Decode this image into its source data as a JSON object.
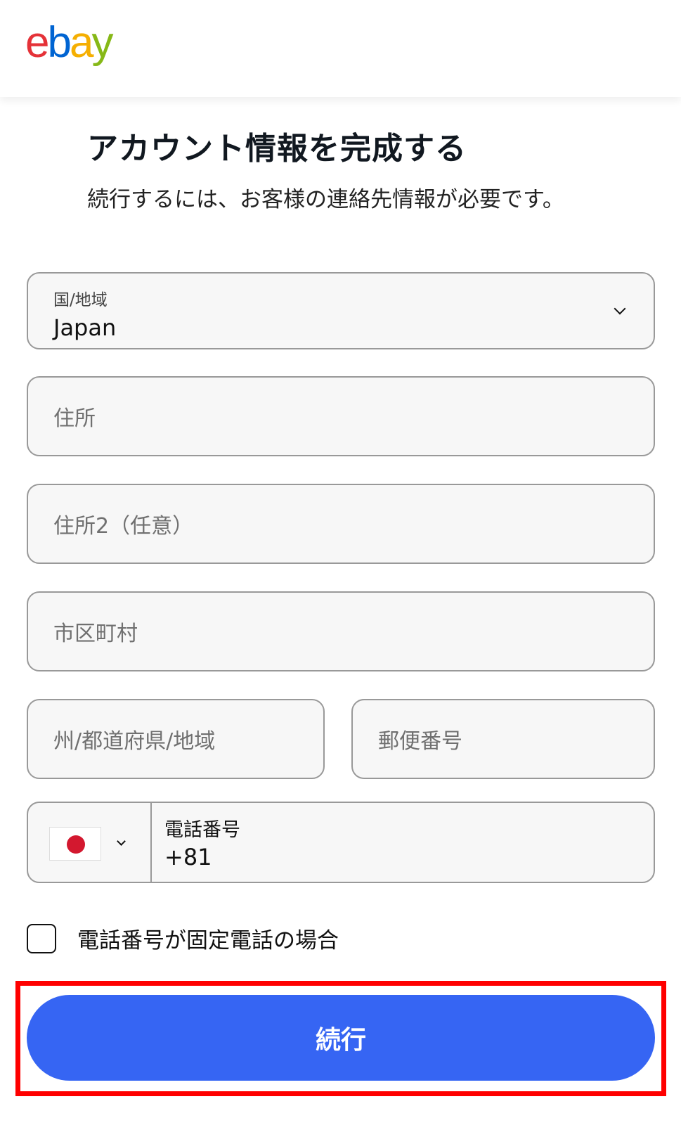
{
  "header": {
    "logo": {
      "e": "e",
      "b": "b",
      "a": "a",
      "y": "y"
    }
  },
  "page": {
    "title": "アカウント情報を完成する",
    "subtitle": "続行するには、お客様の連絡先情報が必要です。"
  },
  "form": {
    "country": {
      "label": "国/地域",
      "value": "Japan"
    },
    "address1": {
      "placeholder": "住所"
    },
    "address2": {
      "placeholder": "住所2（任意）"
    },
    "city": {
      "placeholder": "市区町村"
    },
    "state": {
      "placeholder": "州/都道府県/地域"
    },
    "postal": {
      "placeholder": "郵便番号"
    },
    "phone": {
      "label": "電話番号",
      "value": "+81",
      "flag_icon": "japan-flag-icon"
    },
    "landline_checkbox": {
      "label": "電話番号が固定電話の場合",
      "checked": false
    },
    "continue_label": "続行"
  },
  "colors": {
    "primary_button": "#3665f3",
    "highlight": "#ff0000",
    "logo_e": "#e53238",
    "logo_b": "#0064d2",
    "logo_a": "#f5af02",
    "logo_y": "#86b817"
  }
}
